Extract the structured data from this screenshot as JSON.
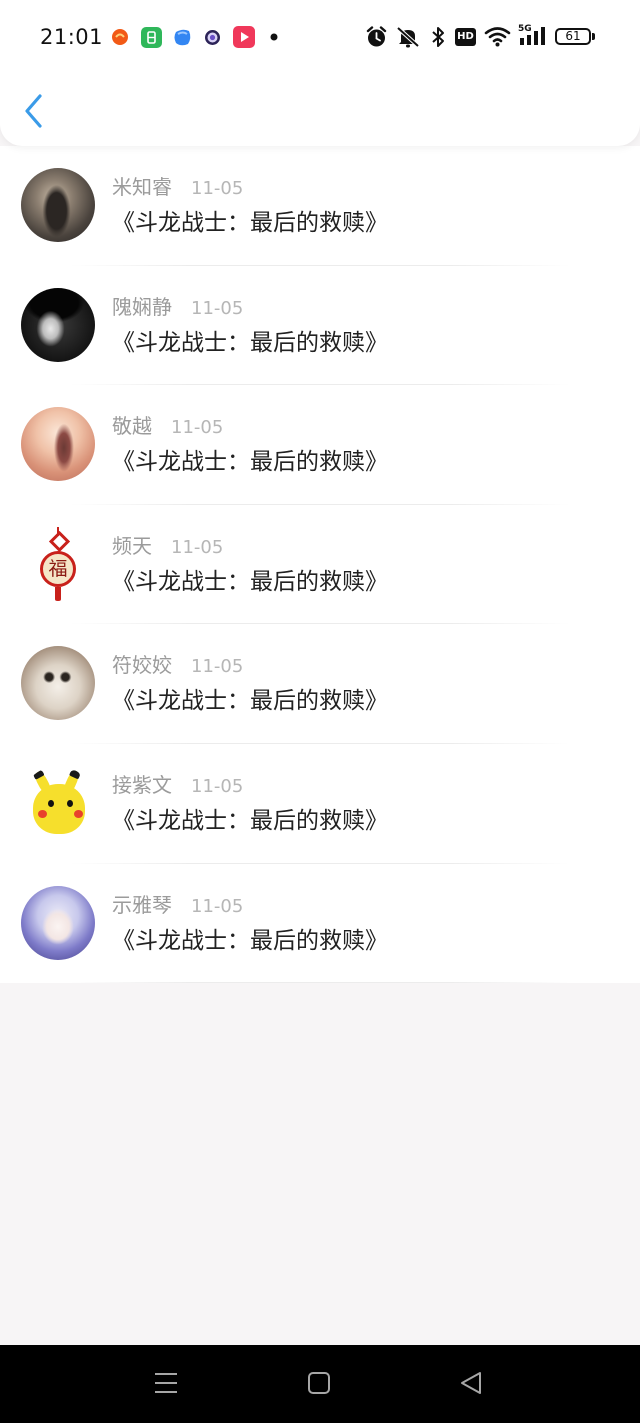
{
  "status_bar": {
    "time": "21:01",
    "notification_icons": [
      "app-orange-icon",
      "app-green-icon",
      "app-blue-icon",
      "app-purple-icon",
      "video-play-icon",
      "more-notifications-dot"
    ],
    "system_icons": [
      "alarm-icon",
      "mute-icon",
      "bluetooth-icon",
      "hd-icon",
      "wifi-icon",
      "signal-5g-icon",
      "battery-icon"
    ],
    "hd_label": "HD",
    "network_label": "5G",
    "battery_level": "61"
  },
  "header": {
    "back_icon": "chevron-left-icon"
  },
  "comments": [
    {
      "name": "米知睿",
      "date": "11-05",
      "text": "《斗龙战士：最后的救赎》"
    },
    {
      "name": "隗娴静",
      "date": "11-05",
      "text": "《斗龙战士：最后的救赎》"
    },
    {
      "name": "敬越",
      "date": "11-05",
      "text": "《斗龙战士：最后的救赎》"
    },
    {
      "name": "频天",
      "date": "11-05",
      "text": "《斗龙战士：最后的救赎》",
      "avatar_glyph": "福"
    },
    {
      "name": "符姣姣",
      "date": "11-05",
      "text": "《斗龙战士：最后的救赎》"
    },
    {
      "name": "接紫文",
      "date": "11-05",
      "text": "《斗龙战士：最后的救赎》"
    },
    {
      "name": "示雅琴",
      "date": "11-05",
      "text": "《斗龙战士：最后的救赎》"
    }
  ],
  "nav_bar": {
    "icons": [
      "menu-icon",
      "home-icon",
      "back-icon"
    ]
  },
  "colors": {
    "accent": "#3a9be8",
    "name": "#9b9b9b",
    "date": "#b6b6b6",
    "text": "#222222",
    "background": "#f7f5f6",
    "navbar": "#000000"
  }
}
